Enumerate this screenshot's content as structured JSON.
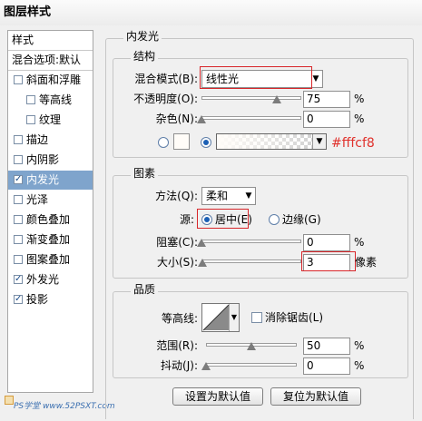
{
  "window": {
    "title": "图层样式"
  },
  "sidebar": {
    "items": [
      {
        "label": "样式",
        "kind": "header"
      },
      {
        "label": "混合选项:默认",
        "kind": "header"
      },
      {
        "label": "斜面和浮雕",
        "checked": false
      },
      {
        "label": "等高线",
        "checked": false,
        "indent": true
      },
      {
        "label": "纹理",
        "checked": false,
        "indent": true
      },
      {
        "label": "描边",
        "checked": false
      },
      {
        "label": "内阴影",
        "checked": false
      },
      {
        "label": "内发光",
        "checked": true,
        "selected": true
      },
      {
        "label": "光泽",
        "checked": false
      },
      {
        "label": "颜色叠加",
        "checked": false
      },
      {
        "label": "渐变叠加",
        "checked": false
      },
      {
        "label": "图案叠加",
        "checked": false
      },
      {
        "label": "外发光",
        "checked": true
      },
      {
        "label": "投影",
        "checked": true
      }
    ],
    "watermark": "PS学堂 www.52PSXT.com"
  },
  "panel": {
    "title": "内发光",
    "structure": {
      "title": "结构",
      "blend_mode_label": "混合模式(B):",
      "blend_mode_value": "线性光",
      "opacity_label": "不透明度(O):",
      "opacity_value": "75",
      "opacity_percent": 75,
      "noise_label": "杂色(N):",
      "noise_value": "0",
      "noise_percent": 0,
      "percent_sign": "%",
      "color_annotation": "#fffcf8",
      "swatch_color": "#fffcf8"
    },
    "elements": {
      "title": "图素",
      "method_label": "方法(Q):",
      "method_value": "柔和",
      "source_label": "源:",
      "source_center": "居中(E)",
      "source_edge": "边缘(G)",
      "choke_label": "阻塞(C):",
      "choke_value": "0",
      "choke_percent": 0,
      "size_label": "大小(S):",
      "size_value": "3",
      "size_unit": "像素",
      "size_fraction": 0.012
    },
    "quality": {
      "title": "品质",
      "contour_label": "等高线:",
      "antialias_label": "消除锯齿(L)",
      "range_label": "范围(R):",
      "range_value": "50",
      "range_percent": 50,
      "jitter_label": "抖动(J):",
      "jitter_value": "0",
      "jitter_percent": 0
    },
    "buttons": {
      "set_default": "设置为默认值",
      "reset_default": "复位为默认值"
    }
  },
  "colors": {
    "accent_selected": "#7fa4cc",
    "annotation_red": "#d8262a"
  }
}
